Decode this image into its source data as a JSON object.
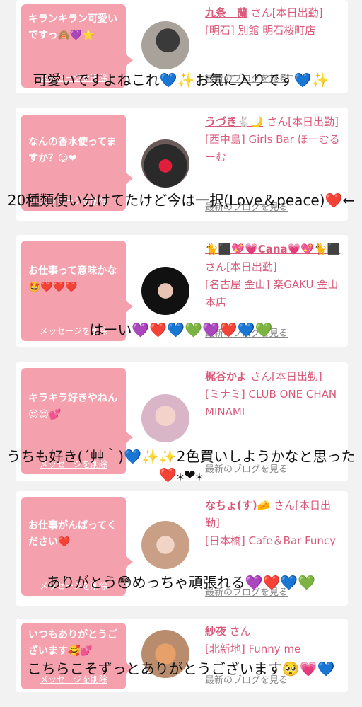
{
  "cards": [
    {
      "message": "キランキラン可愛いですっ🙈💜⭐",
      "delete_label": "メッセージを削除",
      "name": "九条　蘭",
      "suffix": "さん[本日出勤]",
      "area": "[明石] 別館 明石桜町店",
      "blog_label": "最新のブログを見る"
    },
    {
      "message": "なんの香水使ってますか？☺︎❤",
      "delete_label": "メッセージを削除",
      "name": "うづき🐇🌙",
      "suffix": "さん[本日出勤]",
      "area": "[西中島] Girls Bar ほーむるーむ",
      "blog_label": "最新のブログを見る"
    },
    {
      "message": "お仕事って意味かな🤩❤️❤️❤️",
      "delete_label": "メッセージを削除",
      "name": "🐈⬛💖💗Cana💗💖🐈⬛",
      "suffix": "さん[本日出勤]",
      "area": "[名古屋 金山] 楽GAKU 金山本店",
      "blog_label": "最新のブログを見る"
    },
    {
      "message": "キラキラ好きやねん😍😍💕",
      "delete_label": "メッセージを削除",
      "name": "梶谷かよ",
      "suffix": "さん[本日出勤]",
      "area": "[ミナミ] CLUB ONE CHAN MINAMI",
      "blog_label": "最新のブログを見る"
    },
    {
      "message": "お仕事がんばってください❤️",
      "delete_label": "メッセージを削除",
      "name": "なちょ(す)🧀",
      "suffix": "さん[本日出勤]",
      "area": "[日本橋] Cafe＆Bar Funcy",
      "blog_label": "最新のブログを見る"
    },
    {
      "message": "いつもありがとうございます🥰💕",
      "delete_label": "メッセージを削除",
      "name": "紗夜",
      "suffix": "さん",
      "area": "[北新地] Funny me",
      "blog_label": "最新のブログを見る"
    }
  ],
  "overlays": [
    "可愛いですよねこれ💙✨お気に入りです💙✨",
    "20種類使い分けてたけど今は一択(Love＆peace)❤️←",
    "はーい💜❤️💙💚💜❤️💙💚",
    "うちも好き(´艸｀)💙✨✨2色買いしようかなと思った❤️⁎❤⁎",
    "ありがとう😳めっちゃ頑張れる💜❤️💙💚",
    "こちらこそずっとありがとうございます🥺💗💙"
  ],
  "colors": {
    "bubble": "#f5a0ad",
    "name": "#d85a7a",
    "link": "#888888",
    "bg": "#f2f2f2"
  }
}
